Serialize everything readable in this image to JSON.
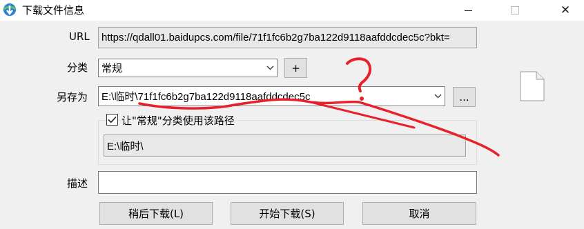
{
  "window": {
    "title": "下载文件信息",
    "app_icon": "idm-globe-icon",
    "controls": {
      "minimize": "minimize-icon",
      "maximize": "maximize-icon",
      "close": "close-icon",
      "close_glyph": "✕"
    }
  },
  "form": {
    "url_label": "URL",
    "url_value": "https://qdall01.baidupcs.com/file/71f1fc6b2g7ba122d9118aafddcdec5c?bkt=",
    "category_label": "分类",
    "category_value": "常规",
    "add_category_label": "+",
    "save_as_label": "另存为",
    "save_as_value": "E:\\临时\\71f1fc6b2g7ba122d9118aafddcdec5c",
    "browse_label": "...",
    "use_path_checkbox_label": "让\"常规\"分类使用该路径",
    "use_path_checked": true,
    "category_path_value": "E:\\临时\\",
    "description_label": "描述",
    "description_value": ""
  },
  "buttons": {
    "later": "稍后下载(L)",
    "start": "开始下载(S)",
    "cancel": "取消"
  },
  "annotation": {
    "mark_text": "?",
    "color": "#e8202a"
  },
  "icons": {
    "file": "file-icon",
    "checkmark": "checkmark-icon",
    "dropdown": "chevron-down-icon"
  }
}
